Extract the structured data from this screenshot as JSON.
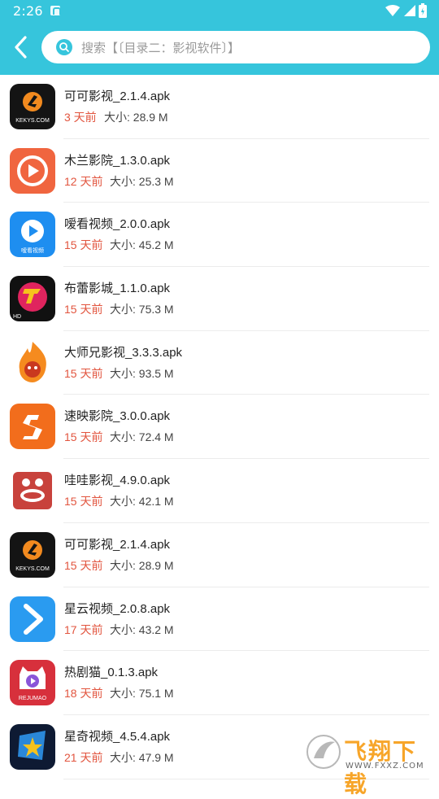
{
  "status_bar": {
    "time": "2:26"
  },
  "header": {
    "search_placeholder": "搜索【〔目录二：影视软件〕】"
  },
  "list": [
    {
      "title": "可可影视_2.1.4.apk",
      "days": "3 天前",
      "size": "大小:  28.9 M",
      "icon": "kekys-icon"
    },
    {
      "title": "木兰影院_1.3.0.apk",
      "days": "12 天前",
      "size": "大小:  25.3 M",
      "icon": "mulan-icon"
    },
    {
      "title": "嗳看视频_2.0.0.apk",
      "days": "15 天前",
      "size": "大小:  45.2 M",
      "icon": "aikan-icon"
    },
    {
      "title": "布蕾影城_1.1.0.apk",
      "days": "15 天前",
      "size": "大小:  75.3 M",
      "icon": "bulei-icon"
    },
    {
      "title": "大师兄影视_3.3.3.apk",
      "days": "15 天前",
      "size": "大小:  93.5 M",
      "icon": "dashixiong-icon"
    },
    {
      "title": "速映影院_3.0.0.apk",
      "days": "15 天前",
      "size": "大小:  72.4 M",
      "icon": "suying-icon"
    },
    {
      "title": "哇哇影视_4.9.0.apk",
      "days": "15 天前",
      "size": "大小:  42.1 M",
      "icon": "wawa-icon"
    },
    {
      "title": "可可影视_2.1.4.apk",
      "days": "15 天前",
      "size": "大小:  28.9 M",
      "icon": "kekys-icon"
    },
    {
      "title": "星云视频_2.0.8.apk",
      "days": "17 天前",
      "size": "大小:  43.2 M",
      "icon": "xingyun-icon"
    },
    {
      "title": "热剧猫_0.1.3.apk",
      "days": "18 天前",
      "size": "大小:  75.1 M",
      "icon": "rejumao-icon"
    },
    {
      "title": "星奇视频_4.5.4.apk",
      "days": "21 天前",
      "size": "大小:  47.9 M",
      "icon": "xingqi-icon"
    }
  ],
  "icon_text": {
    "kekys": "KEKYS.COM",
    "aikan": "嗳看视频",
    "bulei": "HD",
    "rejumao": "REJUMAO"
  },
  "watermark": {
    "brand": "飞翔下载",
    "url": "WWW.FXXZ.COM"
  },
  "colors": {
    "header": "#36c5dc",
    "days_text": "#e2553f",
    "watermark": "#f7a529"
  }
}
